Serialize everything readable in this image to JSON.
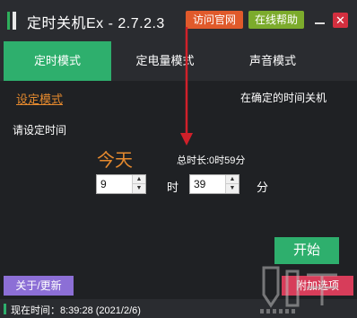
{
  "titlebar": {
    "title": "定时关机Ex - 2.7.2.3",
    "visit_label": "访问官网",
    "help_label": "在线帮助",
    "close_glyph": "✕"
  },
  "tabs": [
    {
      "label": "定时模式",
      "active": true
    },
    {
      "label": "定电量模式",
      "active": false
    },
    {
      "label": "声音模式",
      "active": false
    }
  ],
  "content": {
    "mode_link": "设定模式",
    "mode_value": "在确定的时间关机",
    "prompt": "请设定时间",
    "day_label": "今天",
    "duration": "总时长:0时59分",
    "hour_value": "9",
    "hour_unit": "时",
    "minute_value": "39",
    "minute_unit": "分",
    "start_label": "开始"
  },
  "bottom": {
    "about_label": "关于/更新",
    "extra_label": "附加选项",
    "status_text": "现在时间：8:39:28 (2021/2/6)"
  },
  "colors": {
    "accent_green": "#2eaf6d",
    "orange": "#e68a2e",
    "visit_btn": "#e05a2b",
    "help_btn": "#7cab2c",
    "close_btn": "#d32f3f",
    "about_btn": "#8c6fd6",
    "extra_btn": "#d73d5a",
    "arrow": "#d0202a"
  },
  "icons": {
    "logo": "app-logo-icon",
    "minimize": "minimize-icon",
    "close": "close-icon",
    "spin_up": "chevron-up-icon",
    "spin_down": "chevron-down-icon"
  }
}
